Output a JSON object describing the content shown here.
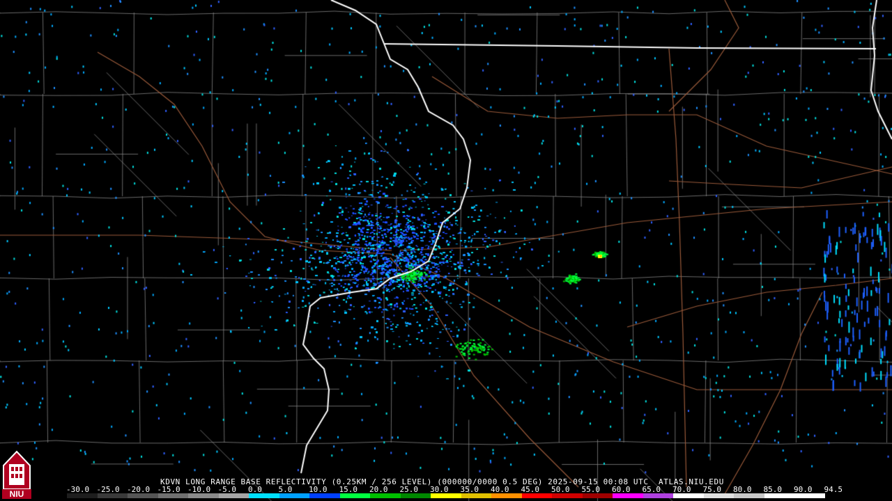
{
  "product": {
    "caption": "KDVN LONG RANGE BASE REFLECTIVITY (0.25KM / 256 LEVEL) (000000/0000 0.5 DEG) 2025-09-15 00:08 UTC  ATLAS.NIU.EDU",
    "logo_text": "NIU"
  },
  "scale": {
    "labels": [
      "-30.0",
      "-25.0",
      "-20.0",
      "-15.0",
      "-10.0",
      "-5.0",
      "0.0",
      "5.0",
      "10.0",
      "15.0",
      "20.0",
      "25.0",
      "30.0",
      "35.0",
      "40.0",
      "45.0",
      "50.0",
      "55.0",
      "60.0",
      "65.0",
      "70.0",
      "75.0",
      "80.0",
      "85.0",
      "90.0",
      "94.5"
    ],
    "colors": [
      "#1e1e1e",
      "#3a3a3a",
      "#555555",
      "#707070",
      "#8a8a8a",
      "#a5a5a5",
      "#00e0ff",
      "#00a0ff",
      "#0040ff",
      "#00ff40",
      "#00c000",
      "#008800",
      "#ffff00",
      "#e0c000",
      "#ff9000",
      "#ff0000",
      "#d00000",
      "#a00000",
      "#ff00ff",
      "#b040e0",
      "#ffffff",
      "#e0e0e0",
      "#c8c8c8",
      "#ffffff",
      "#ffffff"
    ]
  },
  "map": {
    "state_border_color": "#ffffff",
    "county_line_color": "#8c8c8c",
    "highway_color": "#9a5a3a",
    "echo_colors": [
      "#1e90ff",
      "#00c8ff",
      "#00e0e0",
      "#3060ff",
      "#00aaff"
    ],
    "strong_echo_colors": [
      "#00ff40",
      "#00c000",
      "#ffff00"
    ]
  }
}
